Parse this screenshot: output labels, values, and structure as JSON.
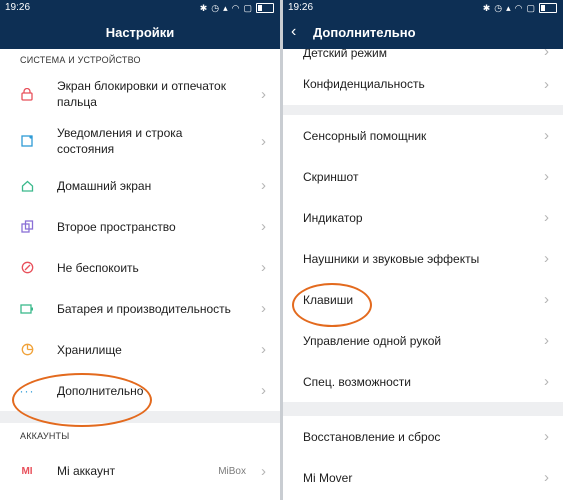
{
  "left": {
    "status_time": "19:26",
    "title": "Настройки",
    "section_system": "СИСТЕМА И УСТРОЙСТВО",
    "items": [
      {
        "label": "Экран блокировки и отпечаток пальца"
      },
      {
        "label": "Уведомления и строка состояния"
      },
      {
        "label": "Домашний экран"
      },
      {
        "label": "Второе пространство"
      },
      {
        "label": "Не беспокоить"
      },
      {
        "label": "Батарея и производительность"
      },
      {
        "label": "Хранилище"
      },
      {
        "label": "Дополнительно"
      }
    ],
    "section_accounts": "АККАУНТЫ",
    "account_label": "Mi аккаунт",
    "account_value": "MiBox"
  },
  "right": {
    "status_time": "19:26",
    "title": "Дополнительно",
    "group1": [
      {
        "label": "Детский режим"
      },
      {
        "label": "Конфиденциальность"
      }
    ],
    "group2": [
      {
        "label": "Сенсорный помощник"
      },
      {
        "label": "Скриншот"
      },
      {
        "label": "Индикатор"
      },
      {
        "label": "Наушники и звуковые эффекты"
      },
      {
        "label": "Клавиши"
      },
      {
        "label": "Управление одной рукой"
      },
      {
        "label": "Спец. возможности"
      }
    ],
    "group3": [
      {
        "label": "Восстановление и сброс"
      },
      {
        "label": "Mi Mover"
      }
    ]
  },
  "colors": {
    "header": "#0d2f54",
    "highlight": "#e36a1e"
  }
}
